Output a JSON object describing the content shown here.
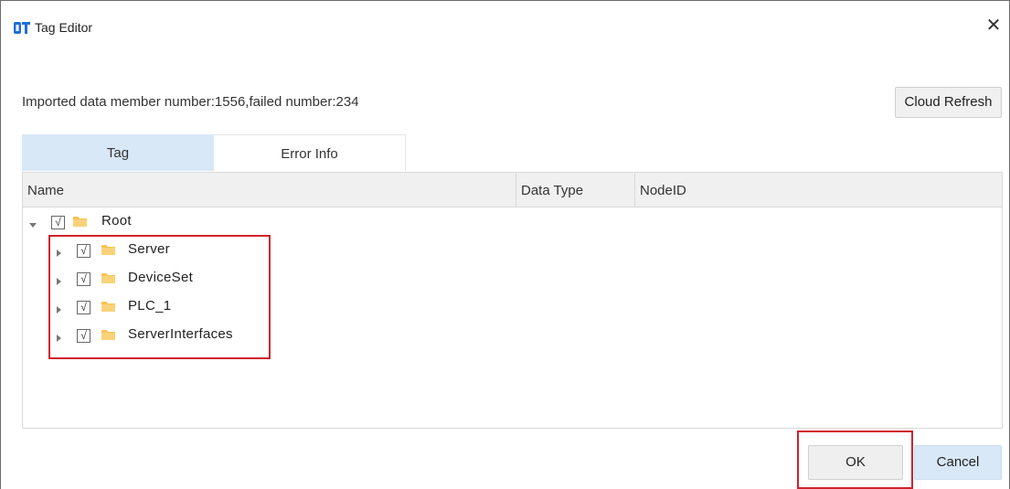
{
  "window": {
    "title": "Tag Editor",
    "app_icon": "dt-logo-icon",
    "close_glyph": "✕"
  },
  "summary": {
    "text": "Imported data member number:1556,failed number:234"
  },
  "toolbar": {
    "cloud_refresh_label": "Cloud Refresh"
  },
  "tabs": [
    {
      "label": "Tag",
      "active": true
    },
    {
      "label": "Error Info",
      "active": false
    }
  ],
  "grid": {
    "columns": [
      "Name",
      "Data Type",
      "NodeID"
    ],
    "rows": [
      {
        "label": "Root",
        "checked": true,
        "expanded": true,
        "depth": 0
      },
      {
        "label": "Server",
        "checked": true,
        "expanded": false,
        "depth": 1
      },
      {
        "label": "DeviceSet",
        "checked": true,
        "expanded": false,
        "depth": 1
      },
      {
        "label": "PLC_1",
        "checked": true,
        "expanded": false,
        "depth": 1
      },
      {
        "label": "ServerInterfaces",
        "checked": true,
        "expanded": false,
        "depth": 1
      }
    ],
    "check_glyph": "√"
  },
  "footer": {
    "ok_label": "OK",
    "cancel_label": "Cancel"
  },
  "colors": {
    "accent_tab": "#d8e8f7",
    "highlight": "#d0222b",
    "folder": "#f6c453"
  }
}
